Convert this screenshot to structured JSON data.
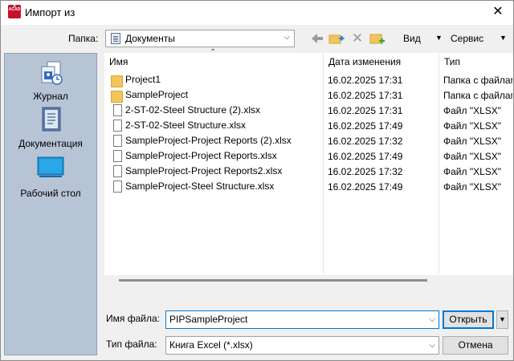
{
  "window": {
    "title": "Импорт из",
    "app_icon_letter": "A",
    "app_icon_sub": "ACAD",
    "close_glyph": "✕"
  },
  "toolbar": {
    "folder_label": "Папка:",
    "folder_value": "Документы",
    "view_label": "Вид",
    "service_label": "Сервис",
    "dropdown_glyph": "⌵",
    "menu_arrow_glyph": "▼",
    "delete_glyph": "✕"
  },
  "places": [
    {
      "label": "Журнал",
      "icon": "history-icon"
    },
    {
      "label": "Документация",
      "icon": "documents-icon"
    },
    {
      "label": "Рабочий стол",
      "icon": "desktop-icon"
    }
  ],
  "filelist": {
    "columns": [
      "Имя",
      "Дата изменения",
      "Тип"
    ],
    "sort_glyph": "⌃",
    "rows": [
      {
        "name": "Project1",
        "date": "16.02.2025 17:31",
        "type": "Папка с файлами",
        "kind": "folder"
      },
      {
        "name": "SampleProject",
        "date": "16.02.2025 17:31",
        "type": "Папка с файлами",
        "kind": "folder"
      },
      {
        "name": "2-ST-02-Steel Structure (2).xlsx",
        "date": "16.02.2025 17:31",
        "type": "Файл \"XLSX\"",
        "kind": "file"
      },
      {
        "name": "2-ST-02-Steel Structure.xlsx",
        "date": "16.02.2025 17:49",
        "type": "Файл \"XLSX\"",
        "kind": "file"
      },
      {
        "name": "SampleProject-Project Reports (2).xlsx",
        "date": "16.02.2025 17:32",
        "type": "Файл \"XLSX\"",
        "kind": "file"
      },
      {
        "name": "SampleProject-Project Reports.xlsx",
        "date": "16.02.2025 17:49",
        "type": "Файл \"XLSX\"",
        "kind": "file"
      },
      {
        "name": "SampleProject-Project Reports2.xlsx",
        "date": "16.02.2025 17:32",
        "type": "Файл \"XLSX\"",
        "kind": "file"
      },
      {
        "name": "SampleProject-Steel Structure.xlsx",
        "date": "16.02.2025 17:49",
        "type": "Файл \"XLSX\"",
        "kind": "file"
      }
    ]
  },
  "bottom": {
    "filename_label": "Имя файла:",
    "filename_value": "PIPSampleProject",
    "filetype_label": "Тип файла:",
    "filetype_value": "Книга Excel (*.xlsx)",
    "open_label": "Открыть",
    "cancel_label": "Отмена"
  }
}
